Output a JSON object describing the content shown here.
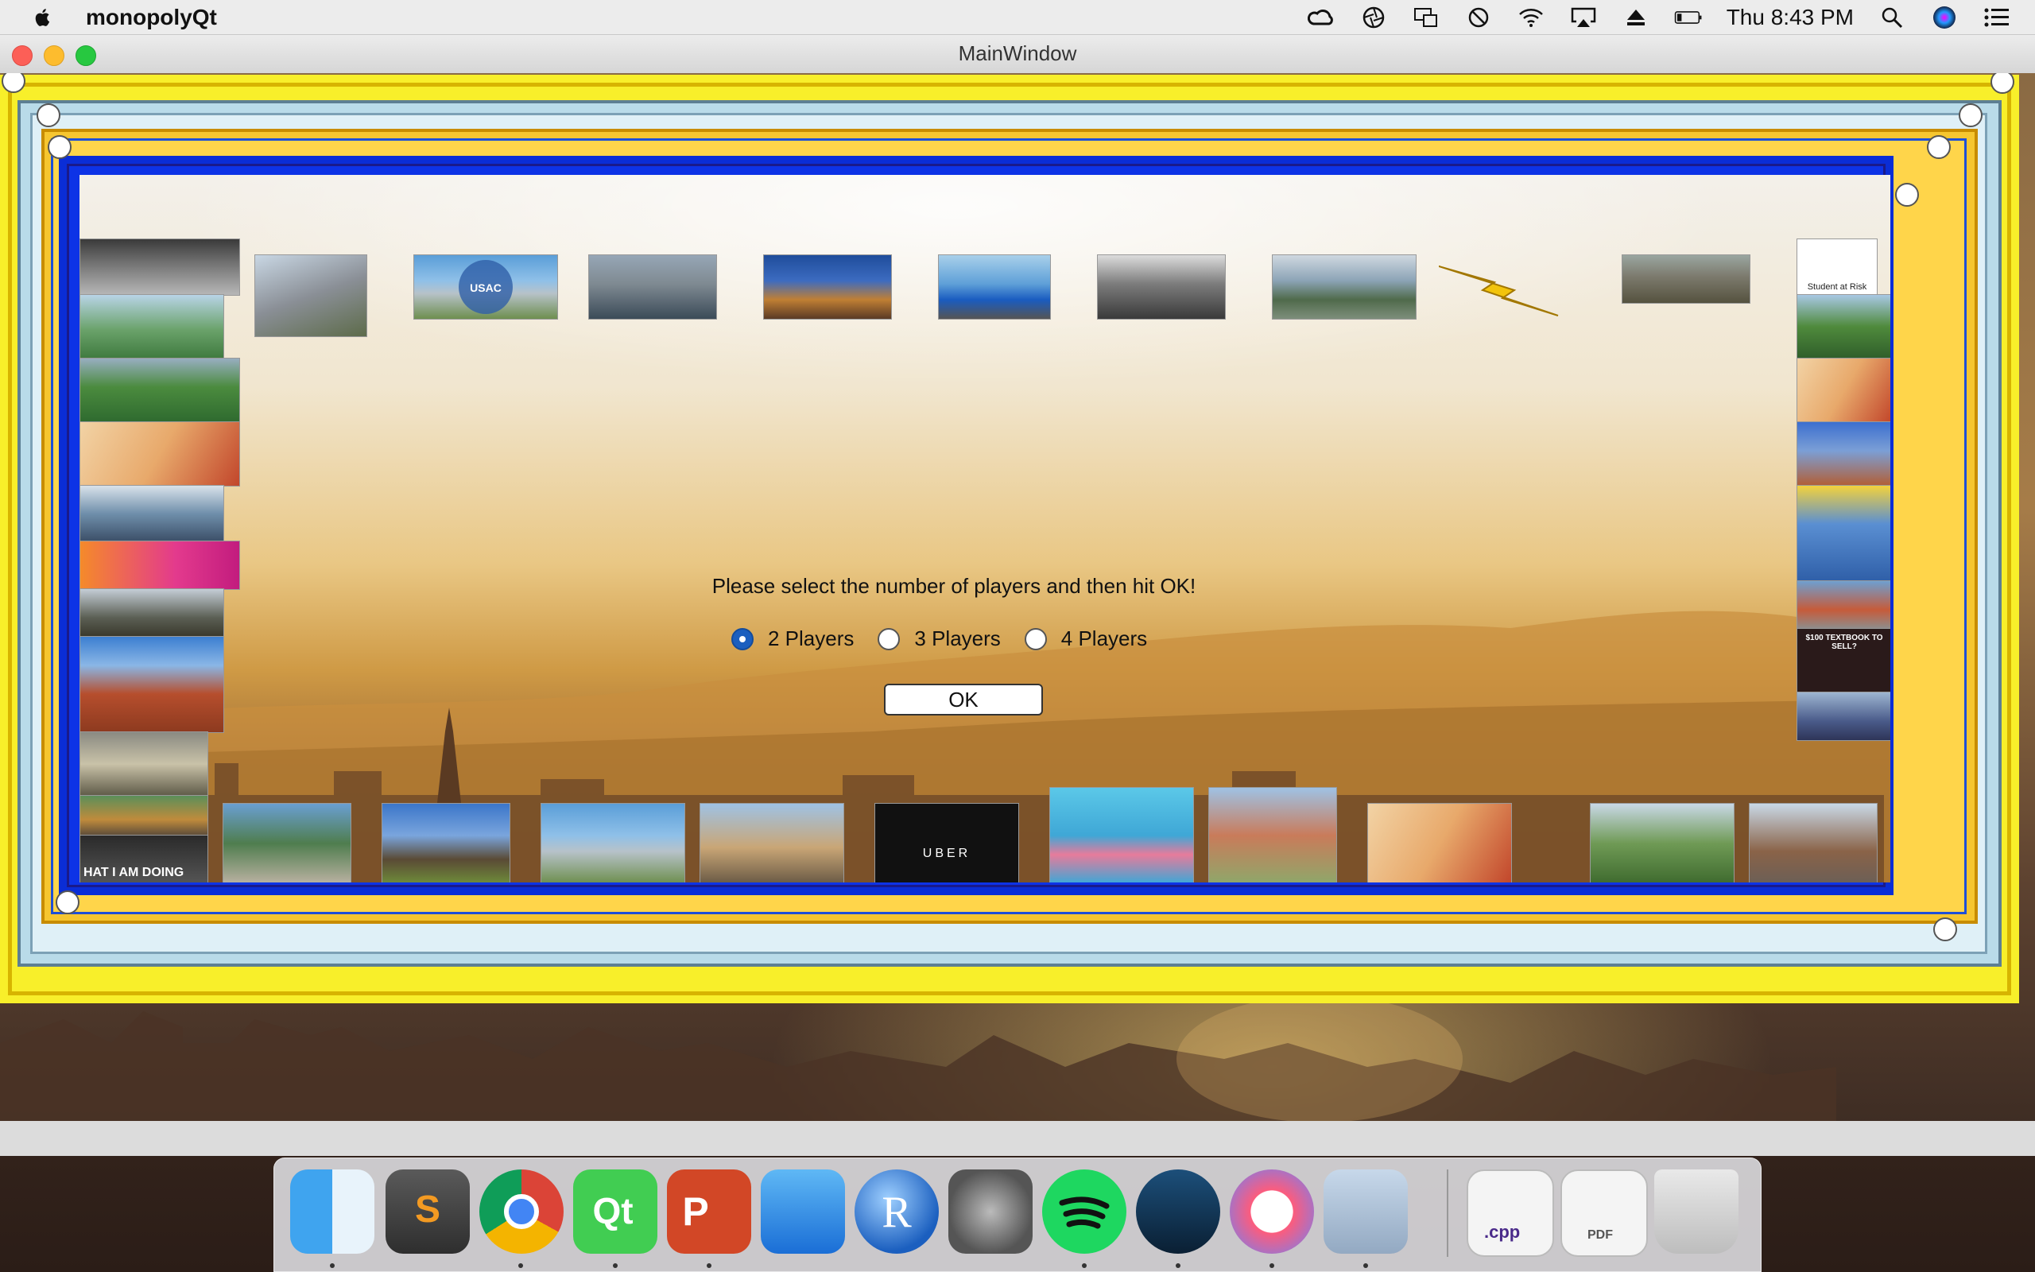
{
  "menubar": {
    "app_name": "monopolyQt",
    "clock": "Thu 8:43 PM",
    "status_icons": [
      "creative-cloud-icon",
      "aperture-icon",
      "screen-mirroring-icon",
      "do-not-disturb-icon",
      "wifi-icon",
      "airplay-icon",
      "eject-icon",
      "battery-icon",
      "spotlight-search-icon",
      "siri-icon",
      "notification-center-icon"
    ]
  },
  "window": {
    "title": "MainWindow"
  },
  "dialog": {
    "prompt": "Please select the number of players and then hit OK!",
    "options": [
      {
        "label": "2 Players",
        "selected": true
      },
      {
        "label": "3 Players",
        "selected": false
      },
      {
        "label": "4 Players",
        "selected": false
      }
    ],
    "ok_label": "OK"
  },
  "board": {
    "tile_texts": {
      "student_at_risk": "Student at Risk",
      "that_i_am_doing": "HAT I AM DOING",
      "uber": "UBER",
      "textbook_sell": "$100 TEXTBOOK TO SELL?",
      "usac": "USAC"
    },
    "colors": {
      "blue": "#0a2dd6",
      "gold": "#f6c630",
      "yellow": "#f8ef2a",
      "lightblue": "#a9cde0"
    }
  },
  "dock": {
    "apps": [
      "finder-icon",
      "sublime-text-icon",
      "chrome-icon",
      "qt-creator-icon",
      "powerpoint-icon",
      "xcode-beta-icon",
      "r-icon",
      "system-preferences-icon",
      "spotify-icon",
      "steam-icon",
      "itunes-icon",
      "instruments-icon"
    ],
    "files": [
      {
        "name": "cpp-file-icon",
        "label": ".cpp"
      },
      {
        "name": "pdf-file-icon",
        "label": "PDF"
      },
      {
        "name": "trash-icon",
        "label": ""
      }
    ]
  }
}
